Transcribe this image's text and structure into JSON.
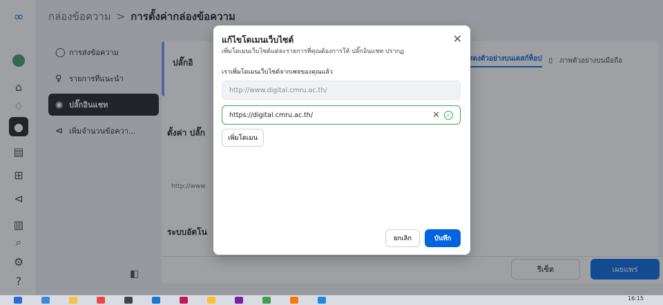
{
  "topbar": {
    "crumb_parent": "กล่องข้อความ",
    "crumb_separator": ">",
    "crumb_current": "การตั้งค่ากล่องข้อความ"
  },
  "subnav": {
    "items": [
      {
        "label": "การส่งข้อความ",
        "icon": "chat-bubble-icon"
      },
      {
        "label": "รายการที่แนะนำ",
        "icon": "lightbulb-icon"
      },
      {
        "label": "ปลั๊กอินแชท",
        "icon": "messenger-icon"
      },
      {
        "label": "เพิ่มจำนวนข้อควา...",
        "icon": "megaphone-icon"
      }
    ]
  },
  "background": {
    "plugin_heading_partial": "ปลั๊กอิ",
    "setup_heading_partial": "ตั้งค่า ปลั๊ก",
    "auto_heading_partial": "ระบบอัตโน",
    "url_partial": "http://www",
    "tab_desktop": "แสดงตัวอย่างบนเดสก์ท็อป",
    "tab_mobile": "ภาพตัวอย่างบนมือถือ",
    "reset_label": "รีเซ็ต",
    "publish_label": "เผยแพร่"
  },
  "modal": {
    "title": "แก้ไขโดเมนเว็บไซต์",
    "description": "เพิ่มโดเมนเว็บไซต์แต่ละรายการที่คุณต้องการให้ ปลั๊กอินแชท ปรากฏ",
    "lead": "เราเพิ่มโดเมนเว็บไซต์จากเพจของคุณแล้ว",
    "existing_domain": "http://www.digital.cmru.ac.th/",
    "new_domain_value": "https://digital.cmru.ac.th/",
    "add_domain_label": "เพิ่มโดเมน",
    "cancel_label": "ยกเลิก",
    "save_label": "บันทึก"
  },
  "taskbar": {
    "time": "16:15"
  }
}
